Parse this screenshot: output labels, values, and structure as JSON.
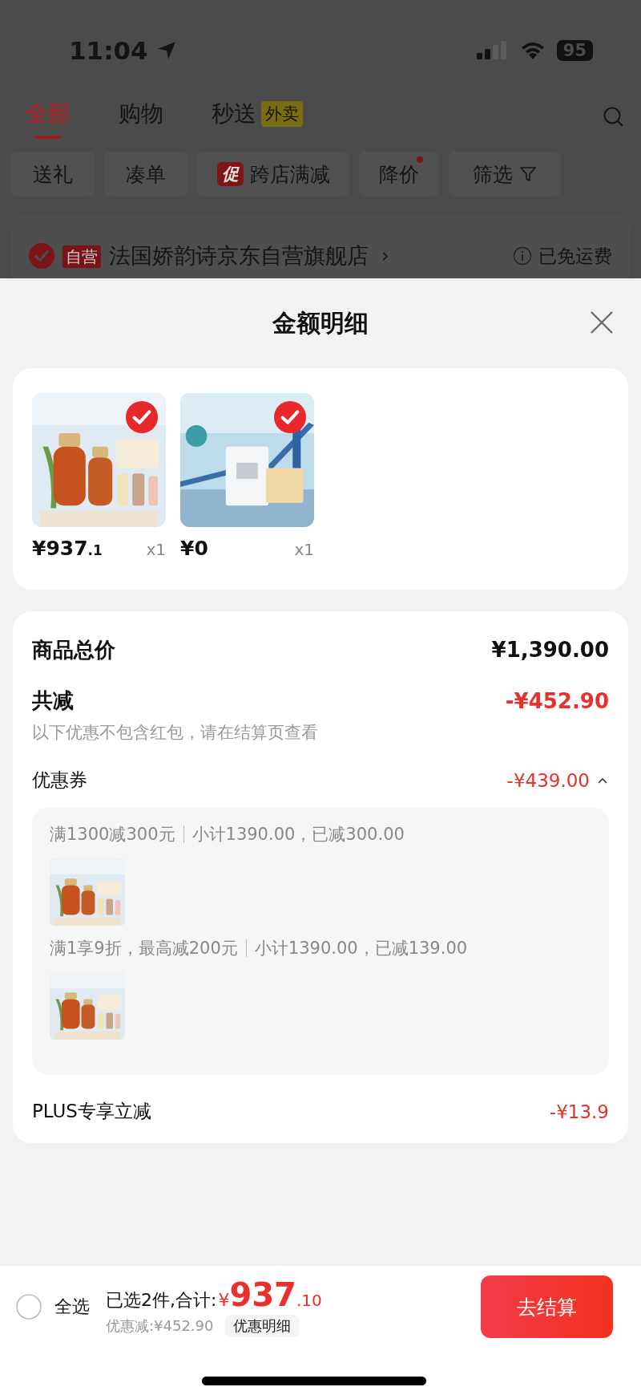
{
  "status_bar": {
    "time": "11:04",
    "battery": "95"
  },
  "tabs": [
    {
      "label": "全部",
      "selected": true
    },
    {
      "label": "购物",
      "selected": false
    },
    {
      "label": "秒送",
      "badge": "外卖",
      "selected": false
    }
  ],
  "filters": [
    {
      "label": "送礼",
      "kind": "plain",
      "dot": false
    },
    {
      "label": "凑单",
      "kind": "plain",
      "dot": false
    },
    {
      "label": "跨店满减",
      "kind": "tagged",
      "tag": "促",
      "dot": false
    },
    {
      "label": "降价",
      "kind": "plain",
      "dot": true
    },
    {
      "label": "筛选",
      "kind": "funnel",
      "dot": false
    }
  ],
  "store": {
    "checked": true,
    "badge": "自营",
    "name": "法国娇韵诗京东自营旗舰店",
    "chevron": "›",
    "shipping": "已免运费"
  },
  "sheet": {
    "title": "金额明细",
    "products": [
      {
        "kind": "serum",
        "checked": true,
        "price": "¥937",
        "price_fraction": ".1",
        "quantity": "x1"
      },
      {
        "kind": "sample",
        "checked": true,
        "price": "¥0",
        "quantity": "x1"
      }
    ],
    "summary": {
      "total": {
        "label": "商品总价",
        "value": "¥1,390.00"
      },
      "reduction": {
        "label": "共减",
        "value": "-¥452.90",
        "note": "以下优惠不包含红包，请在结算页查看"
      },
      "coupons": {
        "label": "优惠券",
        "value": "-¥439.00",
        "expanded": true,
        "groups": [
          {
            "rule": "满1300减300元",
            "subtotal": "小计1390.00，已减300.00",
            "items": [
              {
                "kind": "serum"
              }
            ]
          },
          {
            "rule": "满1享9折，最高减200元",
            "subtotal": "小计1390.00，已减139.00",
            "items": [
              {
                "kind": "serum"
              }
            ]
          }
        ]
      },
      "plus": {
        "label": "PLUS专享立减",
        "value": "-¥13.9"
      }
    }
  },
  "checkout_bar": {
    "select_all": {
      "label": "全选",
      "checked": false
    },
    "selected_text": "已选2件,合计:",
    "currency": "¥",
    "amount": "937",
    "amount_fraction": ".10",
    "discount": "优惠减:¥452.90",
    "detail_button": "优惠明细",
    "checkout_button": "去结算"
  }
}
